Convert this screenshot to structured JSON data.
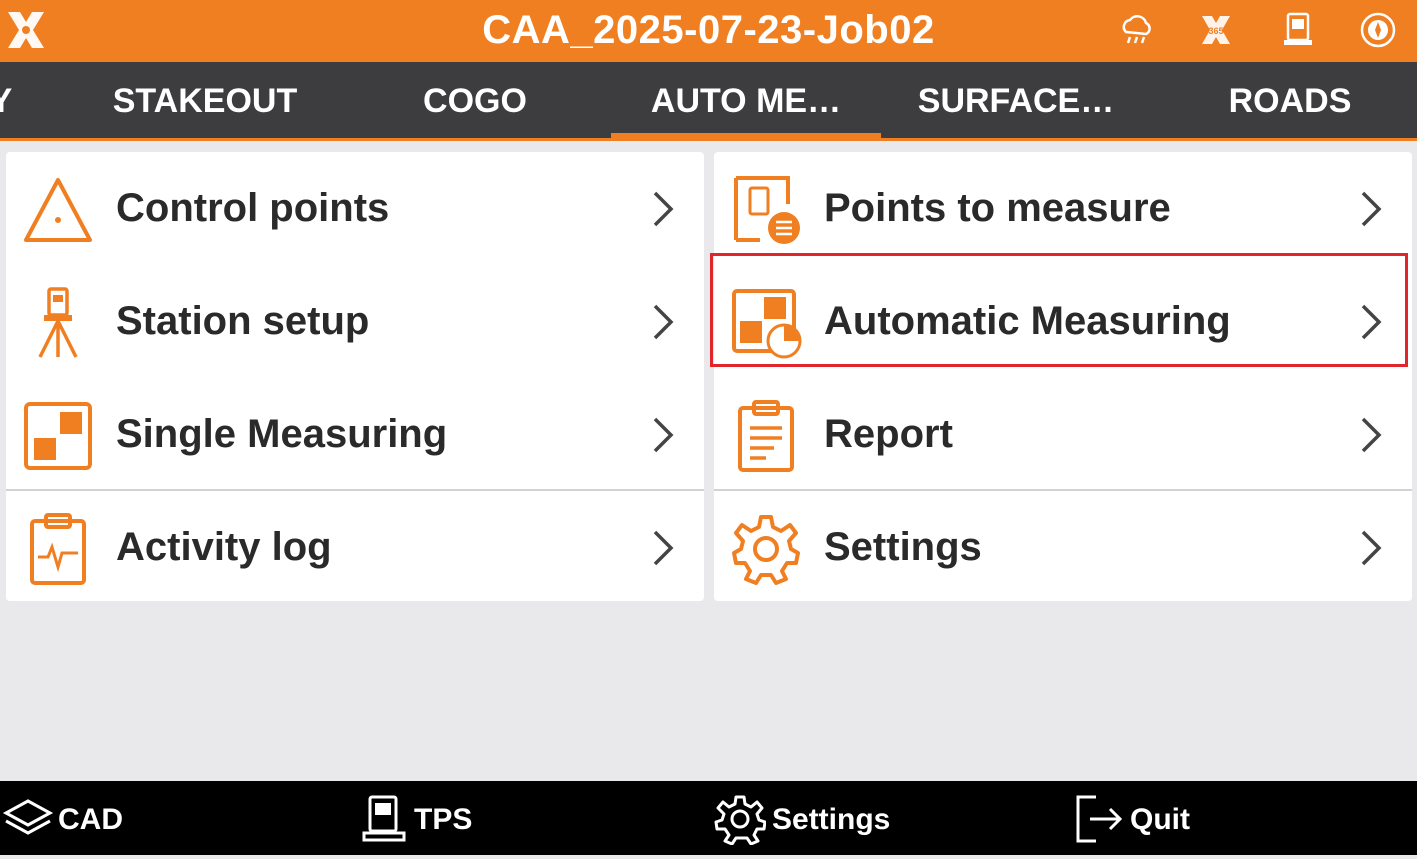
{
  "titlebar": {
    "title": "CAA_2025-07-23-Job02",
    "accent_color": "#f07f22",
    "icons": [
      "app-logo-icon",
      "weather-icon",
      "gnss-rtk-icon",
      "total-station-icon",
      "compass-icon"
    ]
  },
  "tabs": [
    {
      "label": "Y",
      "active": false
    },
    {
      "label": "STAKEOUT",
      "active": false
    },
    {
      "label": "COGO",
      "active": false
    },
    {
      "label": "AUTO ME…",
      "active": true
    },
    {
      "label": "SURFACE…",
      "active": false
    },
    {
      "label": "ROADS",
      "active": false
    }
  ],
  "left_menu": [
    {
      "label": "Control points",
      "icon": "triangle-point-icon"
    },
    {
      "label": "Station setup",
      "icon": "tripod-instrument-icon"
    },
    {
      "label": "Single Measuring",
      "icon": "single-measure-icon"
    },
    {
      "label": "Activity log",
      "icon": "clipboard-pulse-icon"
    }
  ],
  "right_menu": [
    {
      "label": "Points to measure",
      "icon": "points-list-icon"
    },
    {
      "label": "Automatic Measuring",
      "icon": "auto-measure-icon",
      "highlighted": true
    },
    {
      "label": "Report",
      "icon": "report-clipboard-icon"
    },
    {
      "label": "Settings",
      "icon": "gear-icon"
    }
  ],
  "bottombar": {
    "cad": "CAD",
    "tps": "TPS",
    "settings": "Settings",
    "quit": "Quit"
  },
  "colors": {
    "accent": "#f07f22",
    "tabbar": "#3d3d3f",
    "highlight": "#e0262b"
  }
}
